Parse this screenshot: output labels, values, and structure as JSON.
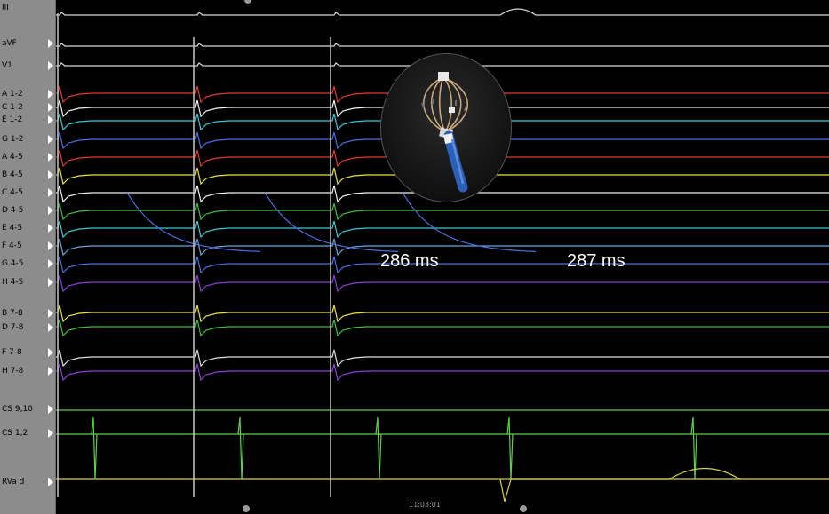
{
  "channels": [
    {
      "label": "III",
      "color": "#d9d9d9"
    },
    {
      "label": "aVF",
      "color": "#d9d9d9"
    },
    {
      "label": "V1",
      "color": "#d9d9d9"
    },
    {
      "label": "A 1-2",
      "color": "#e03a2e"
    },
    {
      "label": "C 1-2",
      "color": "#f2f2f2"
    },
    {
      "label": "E 1-2",
      "color": "#37c8d8"
    },
    {
      "label": "G 1-2",
      "color": "#4b6de0"
    },
    {
      "label": "A 4-5",
      "color": "#e03a2e"
    },
    {
      "label": "B 4-5",
      "color": "#e8e23c"
    },
    {
      "label": "C 4-5",
      "color": "#f2f2f2"
    },
    {
      "label": "D 4-5",
      "color": "#3cbf3a"
    },
    {
      "label": "E 4-5",
      "color": "#37c8d8"
    },
    {
      "label": "F 4-5",
      "color": "#6aa3d8"
    },
    {
      "label": "G 4-5",
      "color": "#4b6de0"
    },
    {
      "label": "H 4-5",
      "color": "#8b3fd8"
    },
    {
      "label": "B 7-8",
      "color": "#e8e23c"
    },
    {
      "label": "D 7-8",
      "color": "#3cbf3a"
    },
    {
      "label": "F 7-8",
      "color": "#e0e0e0"
    },
    {
      "label": "H 7-8",
      "color": "#8b3fd8"
    },
    {
      "label": "CS 9,10",
      "color": "#5fd04a"
    },
    {
      "label": "CS 1,2",
      "color": "#5fd04a"
    },
    {
      "label": "RVa d",
      "color": "#d8d040"
    }
  ],
  "annotations": {
    "interval_1": "286 ms",
    "interval_2": "287 ms"
  },
  "time_readout": "11:03:01",
  "colors": {
    "background": "#000000",
    "label_panel": "#8c8c8c",
    "pacing_spike": "#c8c8c8"
  }
}
